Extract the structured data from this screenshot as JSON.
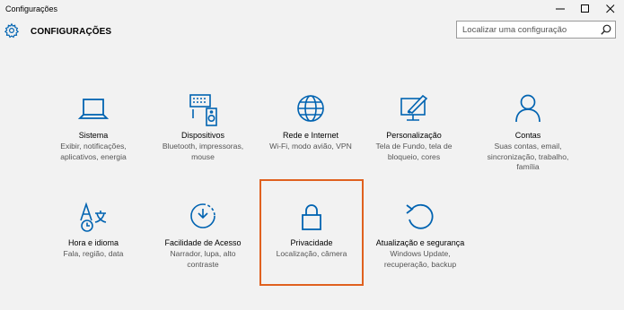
{
  "window": {
    "title": "Configurações",
    "controls": [
      "minimize-icon",
      "maximize-icon",
      "close-icon"
    ]
  },
  "header": {
    "app_title": "CONFIGURAÇÕES",
    "icon": "gear-icon"
  },
  "search": {
    "placeholder": "Localizar uma configuração",
    "value": "",
    "icon": "search-icon"
  },
  "accent": "#0063b1",
  "highlight_color": "#e0611f",
  "tiles": [
    {
      "icon": "laptop-icon",
      "name": "Sistema",
      "desc": [
        "Exibir, notificações,",
        "aplicativos, energia"
      ]
    },
    {
      "icon": "devices-icon",
      "name": "Dispositivos",
      "desc": [
        "Bluetooth, impressoras,",
        "mouse"
      ]
    },
    {
      "icon": "globe-icon",
      "name": "Rede e Internet",
      "desc": [
        "Wi-Fi, modo avião, VPN"
      ]
    },
    {
      "icon": "personalization-icon",
      "name": "Personalização",
      "desc": [
        "Tela de Fundo, tela de",
        "bloqueio, cores"
      ]
    },
    {
      "icon": "person-icon",
      "name": "Contas",
      "desc": [
        "Suas contas, email,",
        "sincronização, trabalho,",
        "família"
      ]
    },
    {
      "icon": "time-language-icon",
      "name": "Hora e idioma",
      "desc": [
        "Fala, região, data"
      ]
    },
    {
      "icon": "ease-of-access-icon",
      "name": "Facilidade de Acesso",
      "desc": [
        "Narrador, lupa, alto",
        "contraste"
      ]
    },
    {
      "icon": "lock-icon",
      "name": "Privacidade",
      "desc": [
        "Localização, câmera"
      ]
    },
    {
      "icon": "update-icon",
      "name": "Atualização e segurança",
      "desc": [
        "Windows Update,",
        "recuperação, backup"
      ]
    }
  ]
}
